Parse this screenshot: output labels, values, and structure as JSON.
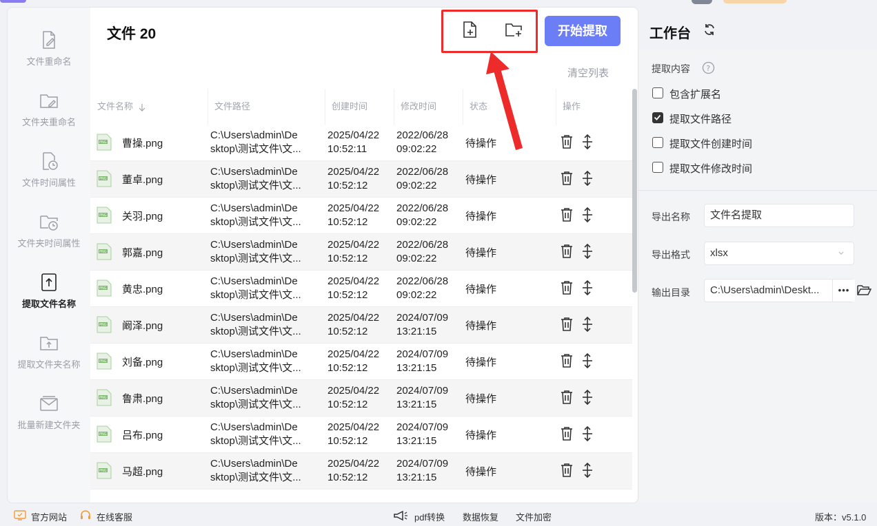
{
  "header": {
    "file_count_title": "文件 20",
    "start_button": "开始提取",
    "clear_list": "清空列表",
    "add_file_icon": "add-file-icon",
    "add_folder_icon": "add-folder-icon"
  },
  "sidebar": {
    "items": [
      {
        "label": "文件重命名",
        "icon": "file-rename-icon"
      },
      {
        "label": "文件夹重命名",
        "icon": "folder-rename-icon"
      },
      {
        "label": "文件时间属性",
        "icon": "file-clock-icon"
      },
      {
        "label": "文件夹时间属性",
        "icon": "folder-clock-icon"
      },
      {
        "label": "提取文件名称",
        "icon": "file-upload-icon",
        "active": true
      },
      {
        "label": "提取文件夹名称",
        "icon": "folder-upload-icon"
      },
      {
        "label": "批量新建文件夹",
        "icon": "batch-folder-icon"
      }
    ]
  },
  "table": {
    "columns": [
      "文件名称",
      "文件路径",
      "创建时间",
      "修改时间",
      "状态",
      "操作"
    ],
    "sort_icon": "sort-down-arrow-icon",
    "rows": [
      {
        "name": "曹操.png",
        "path1": "C:\\Users\\admin\\De",
        "path2": "sktop\\测试文件\\文...",
        "c1": "2025/04/22",
        "c2": "10:52:11",
        "m1": "2022/06/28",
        "m2": "09:02:22",
        "status": "待操作"
      },
      {
        "name": "董卓.png",
        "path1": "C:\\Users\\admin\\De",
        "path2": "sktop\\测试文件\\文...",
        "c1": "2025/04/22",
        "c2": "10:52:12",
        "m1": "2022/06/28",
        "m2": "09:02:22",
        "status": "待操作"
      },
      {
        "name": "关羽.png",
        "path1": "C:\\Users\\admin\\De",
        "path2": "sktop\\测试文件\\文...",
        "c1": "2025/04/22",
        "c2": "10:52:12",
        "m1": "2022/06/28",
        "m2": "09:02:22",
        "status": "待操作"
      },
      {
        "name": "郭嘉.png",
        "path1": "C:\\Users\\admin\\De",
        "path2": "sktop\\测试文件\\文...",
        "c1": "2025/04/22",
        "c2": "10:52:12",
        "m1": "2022/06/28",
        "m2": "09:02:22",
        "status": "待操作"
      },
      {
        "name": "黄忠.png",
        "path1": "C:\\Users\\admin\\De",
        "path2": "sktop\\测试文件\\文...",
        "c1": "2025/04/22",
        "c2": "10:52:12",
        "m1": "2022/06/28",
        "m2": "09:02:22",
        "status": "待操作"
      },
      {
        "name": "阚泽.png",
        "path1": "C:\\Users\\admin\\De",
        "path2": "sktop\\测试文件\\文...",
        "c1": "2025/04/22",
        "c2": "10:52:12",
        "m1": "2024/07/09",
        "m2": "13:21:15",
        "status": "待操作"
      },
      {
        "name": "刘备.png",
        "path1": "C:\\Users\\admin\\De",
        "path2": "sktop\\测试文件\\文...",
        "c1": "2025/04/22",
        "c2": "10:52:12",
        "m1": "2024/07/09",
        "m2": "13:21:15",
        "status": "待操作"
      },
      {
        "name": "鲁肃.png",
        "path1": "C:\\Users\\admin\\De",
        "path2": "sktop\\测试文件\\文...",
        "c1": "2025/04/22",
        "c2": "10:52:12",
        "m1": "2024/07/09",
        "m2": "13:21:15",
        "status": "待操作"
      },
      {
        "name": "吕布.png",
        "path1": "C:\\Users\\admin\\De",
        "path2": "sktop\\测试文件\\文...",
        "c1": "2025/04/22",
        "c2": "10:52:12",
        "m1": "2024/07/09",
        "m2": "13:21:15",
        "status": "待操作"
      },
      {
        "name": "马超.png",
        "path1": "C:\\Users\\admin\\De",
        "path2": "sktop\\测试文件\\文...",
        "c1": "2025/04/22",
        "c2": "10:52:12",
        "m1": "2024/07/09",
        "m2": "13:21:15",
        "status": "待操作"
      }
    ]
  },
  "workbench": {
    "title": "工作台",
    "extract_content_label": "提取内容",
    "options": [
      {
        "label": "包含扩展名",
        "checked": false
      },
      {
        "label": "提取文件路径",
        "checked": true
      },
      {
        "label": "提取文件创建时间",
        "checked": false
      },
      {
        "label": "提取文件修改时间",
        "checked": false
      }
    ],
    "export_name_label": "导出名称",
    "export_name_value": "文件名提取",
    "export_format_label": "导出格式",
    "export_format_value": "xlsx",
    "output_dir_label": "输出目录",
    "output_dir_value": "C:\\Users\\admin\\Deskt...",
    "browse_label": "•••"
  },
  "footer": {
    "website": "官方网站",
    "support": "在线客服",
    "pdf": "pdf转换",
    "recovery": "数据恢复",
    "encrypt": "文件加密",
    "version": "版本：v5.1.0"
  },
  "colors": {
    "accent": "#6c7ef6",
    "highlight_red": "#ee2b2b"
  }
}
